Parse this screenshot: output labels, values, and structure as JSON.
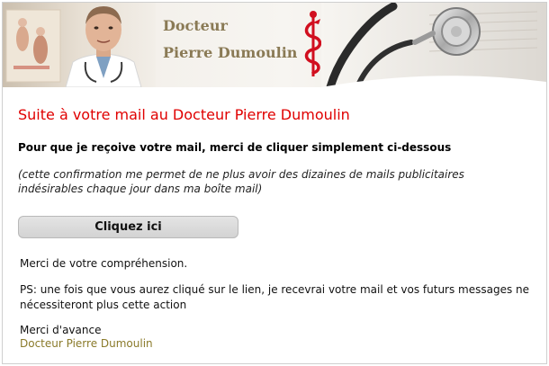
{
  "banner": {
    "title_line1": "Docteur",
    "title_line2": "Pierre Dumoulin"
  },
  "content": {
    "headline": "Suite à votre mail au Docteur Pierre Dumoulin",
    "lead": "Pour que je reçoive votre mail, merci de cliquer simplement ci-dessous",
    "note": "(cette confirmation me permet de ne plus avoir des dizaines de mails publicitaires indésirables chaque jour dans ma boîte mail)",
    "button_label": "Cliquez ici",
    "thanks": "Merci de votre compréhension.",
    "ps": "PS: une fois que vous aurez cliqué sur le lien, je recevrai votre mail et vos futurs messages ne nécessiteront plus cette action",
    "advance_thanks": "Merci d'avance",
    "signature": "Docteur Pierre Dumoulin"
  },
  "colors": {
    "headline": "#e00000",
    "signature": "#8a7a2a",
    "banner_title": "#8a7a55",
    "caduceus": "#d10f1f"
  },
  "icons": {
    "banner_photo": "doctor-portrait-photo",
    "caduceus": "caduceus-icon",
    "stethoscope": "stethoscope-image"
  }
}
